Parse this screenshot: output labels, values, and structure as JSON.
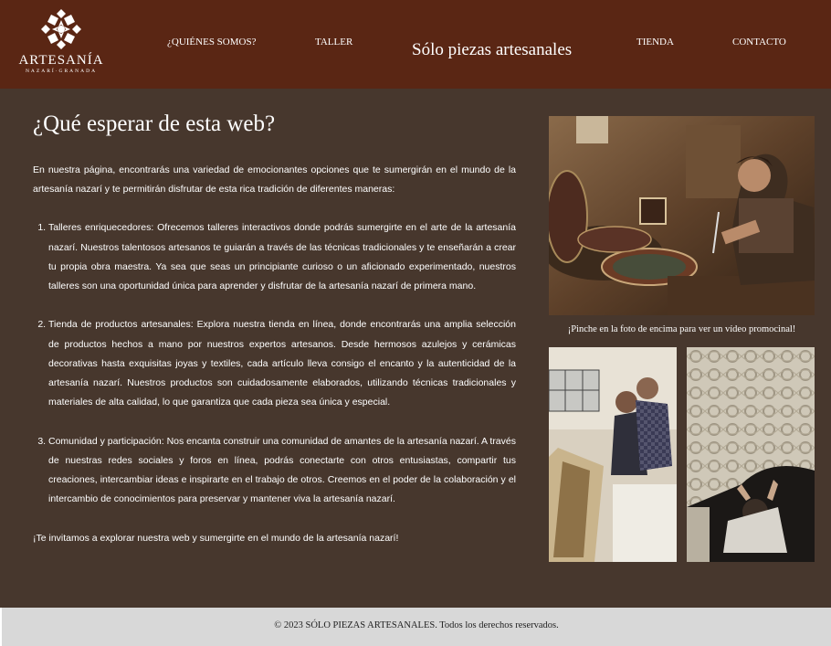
{
  "header": {
    "logo_text": "ARTESANÍA",
    "logo_subtext": "NAZARÍ·GRANADA",
    "site_title": "Sólo piezas artesanales",
    "nav": [
      {
        "label": "¿QUIÉNES SOMOS?"
      },
      {
        "label": "TALLER"
      },
      {
        "label": "TIENDA"
      },
      {
        "label": "CONTACTO"
      }
    ]
  },
  "main": {
    "heading": "¿Qué esperar de esta web?",
    "intro": "En nuestra página, encontrarás una variedad de emocionantes opciones que te sumergirán en el mundo de la artesanía nazarí y te permitirán disfrutar de esta rica tradición de diferentes maneras:",
    "items": [
      "Talleres enriquecedores: Ofrecemos talleres interactivos donde podrás sumergirte en el arte de la artesanía nazarí. Nuestros talentosos artesanos te guiarán a través de las técnicas tradicionales y te enseñarán a crear tu propia obra maestra. Ya sea que seas un principiante curioso o un aficionado experimentado, nuestros talleres son una oportunidad única para aprender y disfrutar de la artesanía nazarí de primera mano.",
      "Tienda de productos artesanales: Explora nuestra tienda en línea, donde encontrarás una amplia selección de productos hechos a mano por nuestros expertos artesanos. Desde hermosos azulejos y cerámicas decorativas hasta exquisitas joyas y textiles, cada artículo lleva consigo el encanto y la autenticidad de la artesanía nazarí. Nuestros productos son cuidadosamente elaborados, utilizando técnicas tradicionales y materiales de alta calidad, lo que garantiza que cada pieza sea única y especial.",
      "Comunidad y participación: Nos encanta construir una comunidad de amantes de la artesanía nazarí. A través de nuestras redes sociales y foros en línea, podrás conectarte con otros entusiastas, compartir tus creaciones, intercambiar ideas e inspirarte en el trabajo de otros. Creemos en el poder de la colaboración y el intercambio de conocimientos para preservar y mantener viva la artesanía nazarí."
    ],
    "outro": "¡Te invitamos a explorar nuestra web y sumergirte en el mundo de la artesanía nazarí!"
  },
  "sidebar": {
    "caption": "¡Pinche en la foto de encima para ver un vídeo promocinal!"
  },
  "footer": {
    "copyright": "© 2023 SÓLO PIEZAS ARTESANALES. Todos los derechos reservados."
  }
}
